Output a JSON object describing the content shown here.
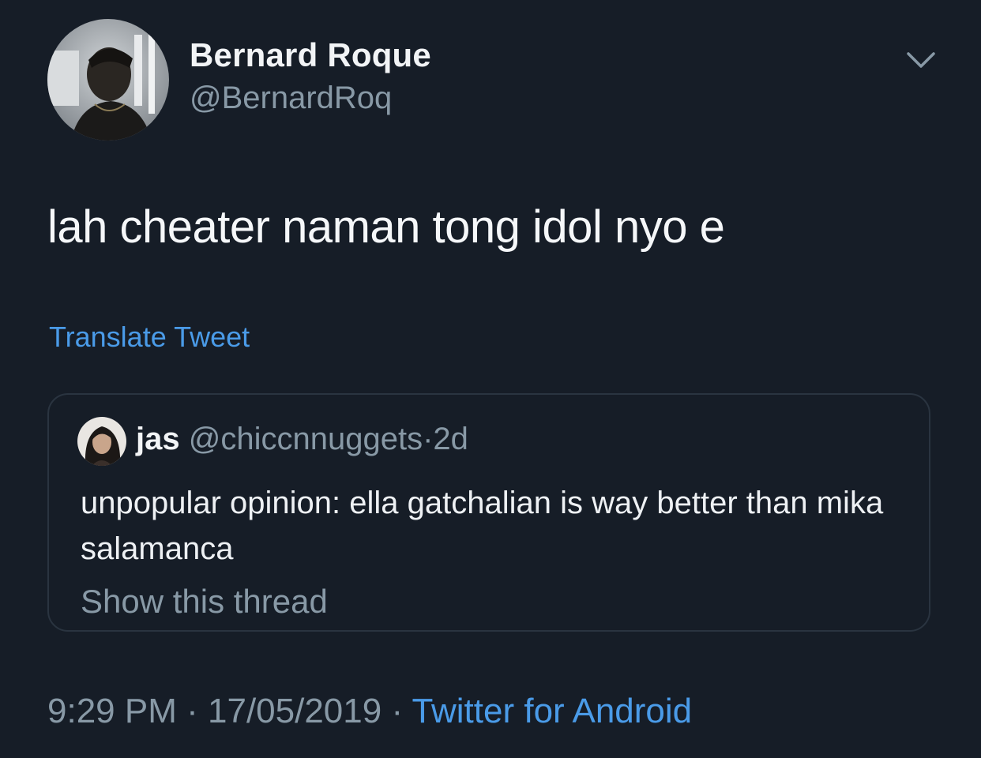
{
  "tweet": {
    "author": {
      "name": "Bernard Roque",
      "handle": "@BernardRoq",
      "avatar_icon": "profile-photo"
    },
    "menu_icon": "chevron-down-icon",
    "text": "lah cheater naman tong idol nyo e",
    "translate_label": "Translate Tweet",
    "quoted": {
      "name": "jas",
      "handle": "@chiccnnuggets",
      "separator": "·",
      "time": "2d",
      "text": "unpopular opinion: ella gatchalian is way better than mika salamanca",
      "show_thread_label": "Show this thread"
    },
    "meta": {
      "time": "9:29 PM",
      "separator1": "·",
      "date": "17/05/2019",
      "separator2": "·",
      "source": "Twitter for Android"
    }
  },
  "colors": {
    "background": "#161d27",
    "link": "#4a9be8",
    "muted": "#8899a6",
    "border": "#2a3440"
  }
}
